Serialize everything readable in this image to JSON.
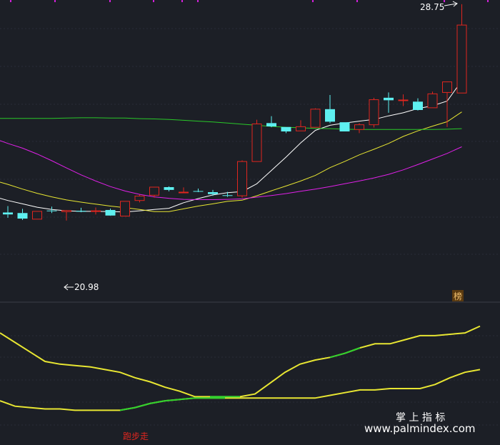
{
  "chart_data": [
    {
      "type": "candlestick",
      "price_range": [
        18.64,
        28.9
      ],
      "high_label": "28.75",
      "low_label": "20.98",
      "badge": "榜",
      "up_color": "#e0261f",
      "down_color": "#5ef0f0",
      "candles": [
        {
          "o": 21.27,
          "h": 21.5,
          "l": 21.08,
          "c": 21.2
        },
        {
          "o": 21.25,
          "h": 21.4,
          "l": 21.0,
          "c": 21.05
        },
        {
          "o": 21.03,
          "h": 21.31,
          "l": 21.03,
          "c": 21.31
        },
        {
          "o": 21.34,
          "h": 21.48,
          "l": 21.25,
          "c": 21.32
        },
        {
          "o": 21.3,
          "h": 21.36,
          "l": 20.98,
          "c": 21.34
        },
        {
          "o": 21.33,
          "h": 21.44,
          "l": 21.28,
          "c": 21.3
        },
        {
          "o": 21.32,
          "h": 21.45,
          "l": 21.2,
          "c": 21.33
        },
        {
          "o": 21.36,
          "h": 21.41,
          "l": 21.15,
          "c": 21.16
        },
        {
          "o": 21.14,
          "h": 21.68,
          "l": 21.14,
          "c": 21.67
        },
        {
          "o": 21.7,
          "h": 21.91,
          "l": 21.63,
          "c": 21.86
        },
        {
          "o": 21.89,
          "h": 22.19,
          "l": 21.8,
          "c": 22.18
        },
        {
          "o": 22.18,
          "h": 22.21,
          "l": 22.03,
          "c": 22.08
        },
        {
          "o": 22.0,
          "h": 22.17,
          "l": 22.0,
          "c": 22.0
        },
        {
          "o": 22.04,
          "h": 22.13,
          "l": 22.0,
          "c": 22.02
        },
        {
          "o": 22.0,
          "h": 22.08,
          "l": 21.87,
          "c": 21.93
        },
        {
          "o": 21.89,
          "h": 22.01,
          "l": 21.83,
          "c": 21.87
        },
        {
          "o": 21.87,
          "h": 23.14,
          "l": 21.8,
          "c": 23.1
        },
        {
          "o": 23.1,
          "h": 24.6,
          "l": 23.1,
          "c": 24.45
        },
        {
          "o": 24.48,
          "h": 24.73,
          "l": 24.33,
          "c": 24.36
        },
        {
          "o": 24.34,
          "h": 24.34,
          "l": 24.12,
          "c": 24.18
        },
        {
          "o": 24.2,
          "h": 24.58,
          "l": 24.2,
          "c": 24.35
        },
        {
          "o": 24.33,
          "h": 25.01,
          "l": 24.33,
          "c": 24.98
        },
        {
          "o": 24.98,
          "h": 25.49,
          "l": 24.48,
          "c": 24.53
        },
        {
          "o": 24.51,
          "h": 24.51,
          "l": 24.18,
          "c": 24.18
        },
        {
          "o": 24.25,
          "h": 24.48,
          "l": 24.12,
          "c": 24.42
        },
        {
          "o": 24.42,
          "h": 25.39,
          "l": 24.32,
          "c": 25.32
        },
        {
          "o": 25.39,
          "h": 25.58,
          "l": 24.85,
          "c": 25.3
        },
        {
          "o": 25.31,
          "h": 25.51,
          "l": 25.09,
          "c": 25.31
        },
        {
          "o": 25.25,
          "h": 25.37,
          "l": 24.93,
          "c": 24.95
        },
        {
          "o": 25.03,
          "h": 25.61,
          "l": 25.03,
          "c": 25.53
        },
        {
          "o": 25.58,
          "h": 25.97,
          "l": 24.34,
          "c": 25.96
        },
        {
          "o": 25.56,
          "h": 28.75,
          "l": 25.56,
          "c": 28.0
        }
      ],
      "ma_lines": [
        {
          "color": "#ffffff",
          "values": [
            21.7,
            21.58,
            21.46,
            21.38,
            21.33,
            21.31,
            21.31,
            21.3,
            21.29,
            21.33,
            21.38,
            21.42,
            21.62,
            21.77,
            21.9,
            21.98,
            22.02,
            22.3,
            22.78,
            23.26,
            23.77,
            24.22,
            24.4,
            24.48,
            24.55,
            24.61,
            24.74,
            24.85,
            25.0,
            25.1,
            25.27,
            26.0
          ]
        },
        {
          "color": "#e8e632",
          "values": [
            22.28,
            22.11,
            21.96,
            21.83,
            21.72,
            21.64,
            21.57,
            21.5,
            21.44,
            21.38,
            21.3,
            21.3,
            21.4,
            21.5,
            21.58,
            21.67,
            21.71,
            21.87,
            22.05,
            22.22,
            22.4,
            22.6,
            22.88,
            23.1,
            23.34,
            23.54,
            23.75,
            24.0,
            24.2,
            24.37,
            24.53,
            24.88
          ]
        },
        {
          "color": "#e020e8",
          "values": [
            23.75,
            23.58,
            23.37,
            23.13,
            22.87,
            22.62,
            22.4,
            22.2,
            22.04,
            21.92,
            21.83,
            21.78,
            21.74,
            21.73,
            21.73,
            21.74,
            21.76,
            21.82,
            21.88,
            21.95,
            22.03,
            22.11,
            22.2,
            22.3,
            22.4,
            22.51,
            22.64,
            22.8,
            22.99,
            23.19,
            23.39,
            23.63
          ]
        },
        {
          "color": "#29c929",
          "values": [
            24.65,
            24.65,
            24.65,
            24.65,
            24.66,
            24.67,
            24.67,
            24.66,
            24.66,
            24.64,
            24.63,
            24.61,
            24.58,
            24.55,
            24.52,
            24.48,
            24.44,
            24.4,
            24.36,
            24.33,
            24.31,
            24.29,
            24.28,
            24.26,
            24.25,
            24.25,
            24.25,
            24.25,
            24.25,
            24.25,
            24.26,
            24.28
          ]
        }
      ]
    },
    {
      "type": "line",
      "caption": "跑步走",
      "value_range": [
        0,
        100
      ],
      "series": [
        {
          "color": "#e8e632",
          "values": [
            81,
            74,
            67,
            60,
            58,
            57,
            56,
            54,
            52,
            48,
            45,
            41,
            38,
            34,
            34,
            34,
            34,
            36,
            44,
            52,
            58,
            61,
            63,
            66,
            70,
            73,
            73,
            76,
            79,
            79,
            80,
            81,
            86
          ]
        },
        {
          "color": "#e8e632",
          "highlight": "#2ed12e",
          "highlight_range": [
            8,
            15
          ],
          "values": [
            31,
            27,
            26,
            25,
            25,
            24,
            24,
            24,
            24,
            26,
            29,
            31,
            32,
            33,
            33,
            33,
            33,
            33,
            33,
            33,
            33,
            33,
            35,
            37,
            39,
            39,
            40,
            40,
            40,
            43,
            48,
            52,
            54
          ]
        }
      ]
    }
  ],
  "watermark": {
    "line1": "掌 上 指 标",
    "line2": "www.palmindex.com"
  }
}
